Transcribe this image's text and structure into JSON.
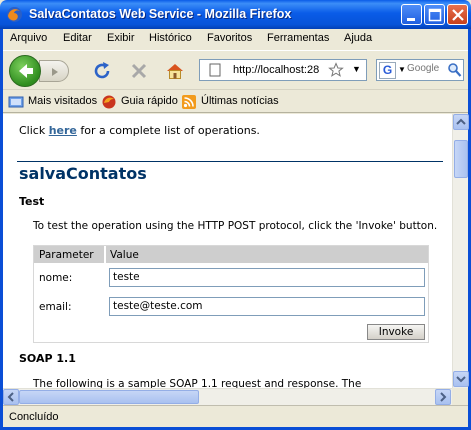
{
  "window": {
    "title": "SalvaContatos Web Service - Mozilla Firefox"
  },
  "menu": [
    "Arquivo",
    "Editar",
    "Exibir",
    "Histórico",
    "Favoritos",
    "Ferramentas",
    "Ajuda"
  ],
  "navbar": {
    "url": "http://localhost:28",
    "search_placeholder": "Google"
  },
  "bookmarks": [
    "Mais visitados",
    "Guia rápido",
    "Últimas notícias"
  ],
  "page": {
    "intro_prefix": "Click ",
    "intro_link": "here",
    "intro_suffix": " for a complete list of operations.",
    "heading": "salvaContatos",
    "test_heading": "Test",
    "test_instructions": "To test the operation using the HTTP POST protocol, click the 'Invoke' button.",
    "table_header_param": "Parameter",
    "table_header_value": "Value",
    "fields": [
      {
        "label": "nome:",
        "value": "teste"
      },
      {
        "label": "email:",
        "value": "teste@teste.com"
      }
    ],
    "invoke_label": "Invoke",
    "soap_heading": "SOAP 1.1",
    "soap_text": "The following is a sample SOAP 1.1 request and response. The"
  },
  "status": {
    "text": "Concluído"
  },
  "colors": {
    "title_blue": "#0a5ce8",
    "heading_navy": "#003366",
    "link": "#336699"
  }
}
